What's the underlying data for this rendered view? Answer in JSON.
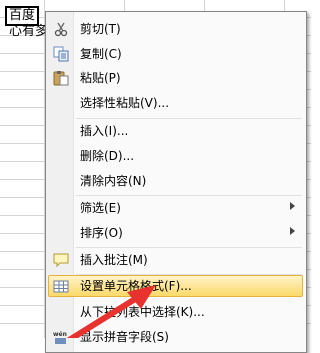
{
  "sheet": {
    "cell_a1": "百度",
    "cell_a2": "心有多"
  },
  "context_menu": {
    "items": [
      {
        "label": "剪切(T)",
        "icon": "scissors-icon"
      },
      {
        "label": "复制(C)",
        "icon": "copy-icon"
      },
      {
        "label": "粘贴(P)",
        "icon": "paste-icon"
      },
      {
        "label": "选择性粘贴(V)..."
      },
      {
        "label": "插入(I)..."
      },
      {
        "label": "删除(D)..."
      },
      {
        "label": "清除内容(N)"
      },
      {
        "label": "筛选(E)",
        "submenu": true
      },
      {
        "label": "排序(O)",
        "submenu": true
      },
      {
        "label": "插入批注(M)",
        "icon": "comment-icon"
      },
      {
        "label": "设置单元格格式(F)...",
        "icon": "format-cells-icon",
        "highlighted": true
      },
      {
        "label": "从下拉列表中选择(K)..."
      },
      {
        "label": "显示拼音字段(S)",
        "icon": "phonetic-icon"
      }
    ]
  },
  "annotation": {
    "arrow_color": "#e8322e"
  }
}
